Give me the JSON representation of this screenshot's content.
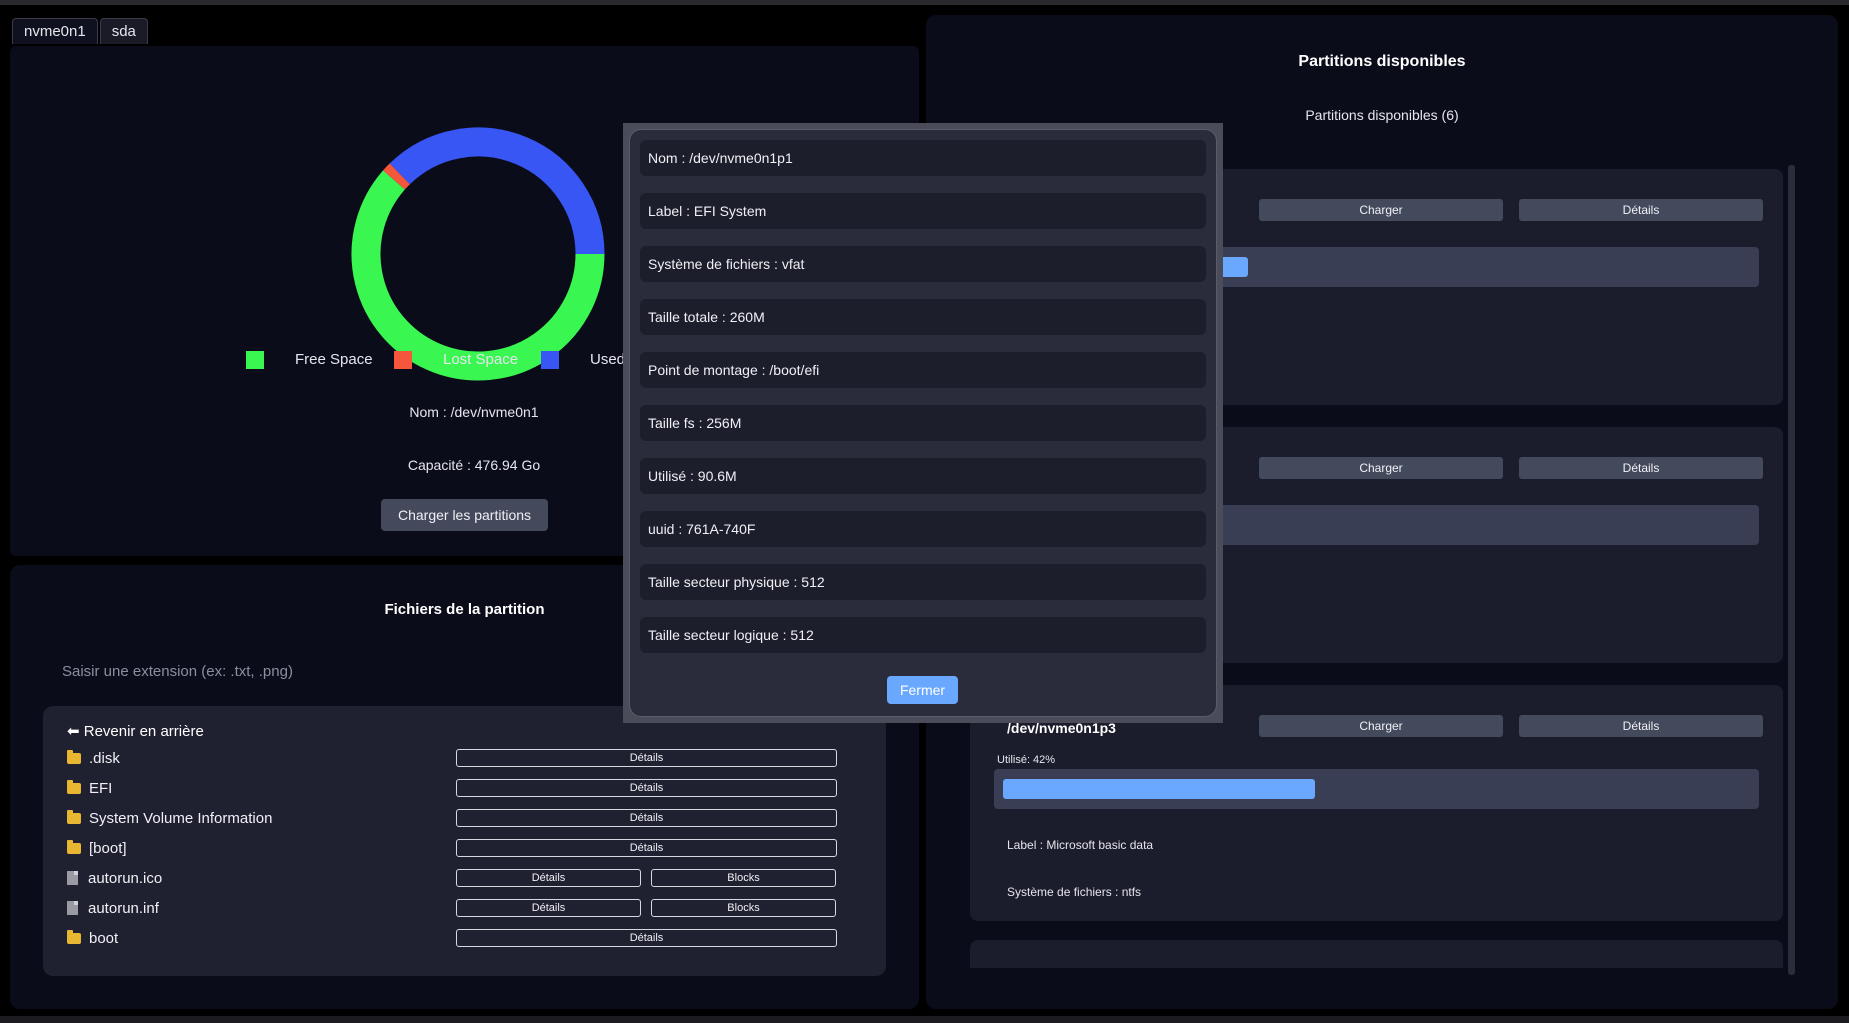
{
  "tabs": [
    {
      "label": "nvme0n1"
    },
    {
      "label": "sda"
    }
  ],
  "colors": {
    "free": "#39f651",
    "lost": "#f4573c",
    "used": "#3856f4",
    "accent": "#6aa8ff",
    "panel": "#0b0c1a"
  },
  "disk": {
    "legend": [
      "Free Space",
      "Lost Space",
      "Used"
    ],
    "name": "Nom : /dev/nvme0n1",
    "capacity": "Capacité : 476.94 Go",
    "load_button": "Charger les partitions"
  },
  "chart_data": {
    "type": "pie",
    "categories": [
      "Free Space",
      "Lost Space",
      "Used"
    ],
    "values": [
      61.5,
      1.2,
      37.3
    ],
    "legend": "bottom"
  },
  "files": {
    "title": "Fichiers de la partition",
    "ext_placeholder": "Saisir une extension (ex: .txt, .png)",
    "back_label": "⬅ Revenir en arrière",
    "details_label": "Détails",
    "blocks_label": "Blocks",
    "items": [
      {
        "name": ".disk",
        "type": "folder"
      },
      {
        "name": "EFI",
        "type": "folder"
      },
      {
        "name": "System Volume Information",
        "type": "folder"
      },
      {
        "name": "[boot]",
        "type": "folder"
      },
      {
        "name": "autorun.ico",
        "type": "file"
      },
      {
        "name": "autorun.inf",
        "type": "file"
      },
      {
        "name": "boot",
        "type": "folder"
      }
    ]
  },
  "partitions": {
    "title": "Partitions disponibles",
    "count_label": "Partitions disponibles (6)",
    "load_label": "Charger",
    "details_label": "Détails",
    "cards": [
      {
        "name": "",
        "usage": 0.25
      },
      {
        "name": "",
        "usage": 0.0
      },
      {
        "name": "/dev/nvme0n1p3",
        "usage_label": "Utilisé: 42%",
        "usage": 0.42,
        "label": "Label : Microsoft basic data",
        "fs": "Système de fichiers : ntfs"
      }
    ]
  },
  "modal": {
    "rows": [
      "Nom : /dev/nvme0n1p1",
      "Label : EFI System",
      "Système de fichiers : vfat",
      "Taille totale : 260M",
      "Point de montage : /boot/efi",
      "Taille fs : 256M",
      "Utilisé : 90.6M",
      "uuid : 761A-740F",
      "Taille secteur physique : 512",
      "Taille secteur logique : 512"
    ],
    "close_label": "Fermer"
  }
}
